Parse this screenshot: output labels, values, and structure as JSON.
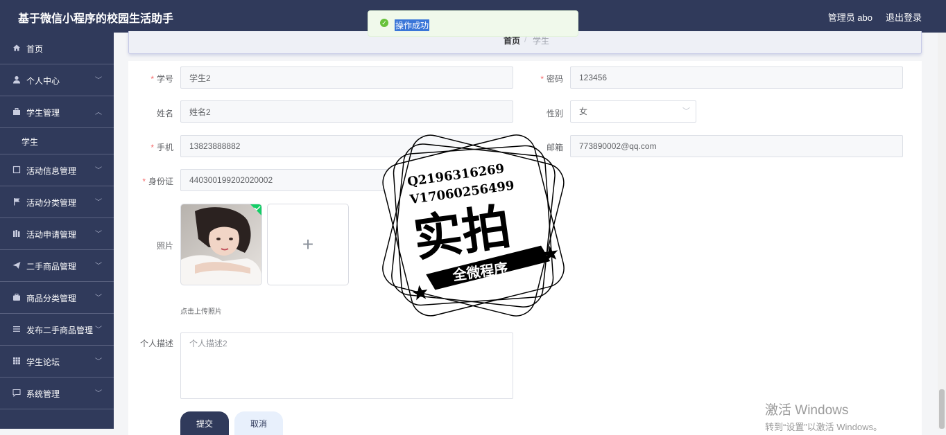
{
  "app": {
    "title": "基于微信小程序的校园生活助手"
  },
  "header": {
    "user": "管理员 abo",
    "logout": "退出登录"
  },
  "toast": {
    "message": "操作成功",
    "type": "success"
  },
  "breadcrumb": {
    "home": "首页",
    "separator": "/",
    "current": "学生"
  },
  "sidebar": {
    "items": [
      {
        "label": "首页",
        "icon": "home-icon"
      },
      {
        "label": "个人中心",
        "icon": "user-icon"
      },
      {
        "label": "学生管理",
        "icon": "briefcase-icon",
        "expanded": true,
        "children": [
          "学生"
        ]
      },
      {
        "label": "活动信息管理",
        "icon": "square-icon"
      },
      {
        "label": "活动分类管理",
        "icon": "flag-icon"
      },
      {
        "label": "活动申请管理",
        "icon": "book-icon"
      },
      {
        "label": "二手商品管理",
        "icon": "send-icon"
      },
      {
        "label": "商品分类管理",
        "icon": "suitcase-icon"
      },
      {
        "label": "发布二手商品管理",
        "icon": "list-icon"
      },
      {
        "label": "学生论坛",
        "icon": "grid-icon"
      },
      {
        "label": "系统管理",
        "icon": "chat-icon"
      }
    ]
  },
  "form": {
    "student_id": {
      "label": "学号",
      "value": "学生2",
      "required": true
    },
    "password": {
      "label": "密码",
      "value": "123456",
      "required": true
    },
    "name": {
      "label": "姓名",
      "value": "姓名2"
    },
    "gender": {
      "label": "性别",
      "value": "女"
    },
    "phone": {
      "label": "手机",
      "value": "13823888882",
      "required": true
    },
    "email": {
      "label": "邮箱",
      "value": "773890002@qq.com"
    },
    "id_card": {
      "label": "身份证",
      "value": "440300199202020002",
      "required": true
    },
    "photo": {
      "label": "照片",
      "hint": "点击上传照片"
    },
    "description": {
      "label": "个人描述",
      "value": "个人描述2"
    },
    "submit": "提交",
    "cancel": "取消"
  },
  "watermark": {
    "line1": "Q2196316269",
    "line2": "V17060256499",
    "big": "实拍",
    "banner": "全微程序"
  },
  "windows_activation": {
    "title": "激活 Windows",
    "subtitle": "转到“设置”以激活 Windows。"
  },
  "colors": {
    "nav_bg": "#303a5b",
    "success": "#67c23a",
    "required": "#f56c6c",
    "primary_button": "#303a5b",
    "cancel_button": "#e8f0fc"
  }
}
